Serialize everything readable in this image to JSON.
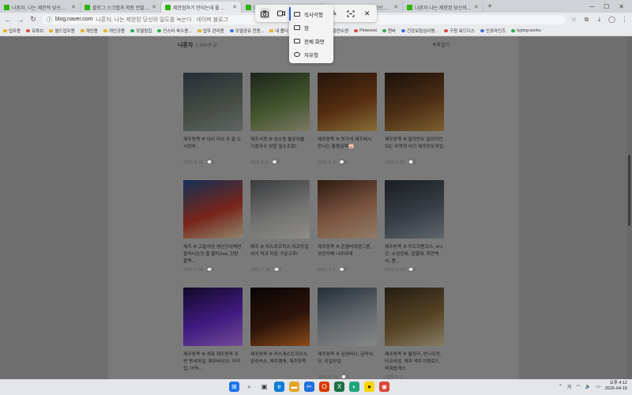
{
  "browser": {
    "tabs": [
      {
        "label": "나혼자, 나는 제한적 당신의 밀도"
      },
      {
        "label": "블로그 스크랩과 저장 전말 | Nav"
      },
      {
        "label": "제한접하기 안되는데 풀 ...",
        "active": true
      },
      {
        "label": "나혼자 나는 제한된 당신의 필드 ..."
      },
      {
        "label": "나혼자, 나는 제한된 당신의 밀도를 녹..."
      },
      {
        "label": "나혼자 나는 제한된 당신의 밀도 녹..."
      }
    ],
    "newtab": "+",
    "address": {
      "url": "blog.naver.com",
      "page_title": "나혼자, 나는 제한된 당신의 밀도를 녹는다 : 네이버 블로그"
    },
    "bookmarks": [
      "업무용",
      "유튜브",
      "월드업무용",
      "개인용",
      "개인공용",
      "모델링집",
      "인스타 육수용...",
      "업무 관리용",
      "모델공유 친용...",
      "내 폴더",
      "ChatGPT",
      "보험연수원",
      "Pinterest",
      "캔바",
      "건강보험심사평...",
      "구청 워드디스",
      "인포라인즈",
      "typing works"
    ]
  },
  "blog": {
    "list_title": "나혼자",
    "list_count": "1,589개 글",
    "collapse_label": "목록열기",
    "posts": [
      {
        "title": "제주동쪽 ❊ 아이 라브 조 끝 오시양자",
        "date": "2025. 8. 11.",
        "comments": "0",
        "colors": [
          "#3b4a5a",
          "#6f7a6c",
          "#9aa3a0"
        ]
      },
      {
        "title": "제주시청 ❊ 성수동 돌문어을 기중국수 상합 필수조합!",
        "date": "2025. 8. 9.",
        "comments": "0",
        "colors": [
          "#2e3a2a",
          "#6b8a4a",
          "#c8c1a2"
        ]
      },
      {
        "title": "제주동쪽 ❊ 멋가석 제주에서 만나는 돌종심육🐷",
        "date": "2025. 8. 2.",
        "comments": "0",
        "colors": [
          "#3a2214",
          "#8a4a1a",
          "#d9b15a"
        ]
      },
      {
        "title": "제주동쪽 ❊ 할랴만두 알려지만 되는 무작정 여기 제주만두맛집",
        "date": "2025. 7. 30.",
        "comments": "0",
        "colors": [
          "#2a1a10",
          "#7a4a22",
          "#c89a4a"
        ]
      },
      {
        "title": "제주 ❊ 고흥식당 생선구이백반 할머니손맛 홈 불티(hot, 간판블랙...",
        "date": "2025. 7. 26.",
        "comments": "0",
        "colors": [
          "#1f4f8a",
          "#c23a2a",
          "#e6d7b0"
        ]
      },
      {
        "title": "제주 ❊ 라스포르피스 이코맛집 여기 덕코 터픈 구운고추!",
        "date": "2025. 7. 24.",
        "comments": "0",
        "colors": [
          "#5b5f63",
          "#b7b7b5",
          "#e8e4da"
        ]
      },
      {
        "title": "제주동쪽 ❊ 존향비대편그론, 성산카페 나무아래",
        "date": "2025. 7. 9.",
        "comments": "0",
        "colors": [
          "#4a2a18",
          "#c88a6a",
          "#e8c9a6"
        ]
      },
      {
        "title": "제주동쪽 ❊ 우도히켄코스, 4시간, 소섬전복, 검멸래, 하얀백사, 몽...",
        "date": "2025. 6. 14.",
        "comments": "0",
        "colors": [
          "#2a3038",
          "#5a6470",
          "#9aa4ae"
        ]
      },
      {
        "title": "제주동쪽 ❊ 개화 제주동쪽 주변 동네마실, 제주바이브, 커피집, 어떡...",
        "date": "",
        "comments": "",
        "colors": [
          "#1a1040",
          "#6a2ad0",
          "#b77af0"
        ]
      },
      {
        "title": "제주동쪽 ❊ 라스게스트하우스, 감성숙소, 제주캠핑, 제주동쪽",
        "date": "",
        "comments": "",
        "colors": [
          "#0a0808",
          "#4a2010",
          "#e07a2a"
        ]
      },
      {
        "title": "제주동쪽 ❊ 김녕바다, 곰막식당, 모일모일",
        "date": "2025. 5. 14.",
        "comments": "0",
        "colors": [
          "#3a4a5a",
          "#a0a8b0",
          "#d8dcd8"
        ]
      },
      {
        "title": "제주동쪽 ❊ 월정리, 반나조맛, 타코라임, 제주 맥주기행로드, 육회숍게스",
        "date": "2025. 5. 2.",
        "comments": "",
        "colors": [
          "#3a3020",
          "#8a6a3a",
          "#d8c8a0"
        ]
      }
    ]
  },
  "snipping": {
    "capture_icon": "camera-icon",
    "video_icon": "video-icon",
    "mode_icon": "rectangle-mode-icon",
    "pen_icon": "pen-icon",
    "ai_icon": "text-extract-icon",
    "close_icon": "close-icon",
    "modes": [
      {
        "label": "직사각형",
        "selected": true
      },
      {
        "label": "창"
      },
      {
        "label": "전체 화면"
      },
      {
        "label": "자유형"
      }
    ]
  },
  "taskbar": {
    "apps": [
      {
        "icon": "windows-start-icon",
        "color": "#1a73e8",
        "glyph": "⊞"
      },
      {
        "icon": "search-icon",
        "color": "#444",
        "glyph": "⌕"
      },
      {
        "icon": "task-view-icon",
        "color": "#333",
        "glyph": "▣"
      },
      {
        "icon": "edge-icon",
        "color": "#0c7cd5",
        "glyph": "e"
      },
      {
        "icon": "file-explorer-icon",
        "color": "#e2a52a",
        "glyph": "▬"
      },
      {
        "icon": "snipping-icon",
        "color": "#1f6fdc",
        "glyph": "✂"
      },
      {
        "icon": "office-icon",
        "color": "#d83b01",
        "glyph": "O"
      },
      {
        "icon": "excel-icon",
        "color": "#1d7044",
        "glyph": "X"
      },
      {
        "icon": "whale-icon",
        "color": "#1ea57a",
        "glyph": "◐"
      },
      {
        "icon": "kakaotalk-icon",
        "color": "#f7d600",
        "glyph": "●"
      },
      {
        "icon": "chrome-icon",
        "color": "#db4437",
        "glyph": "◉"
      }
    ],
    "time": "오후 4:12",
    "date": "2026-04-16"
  }
}
